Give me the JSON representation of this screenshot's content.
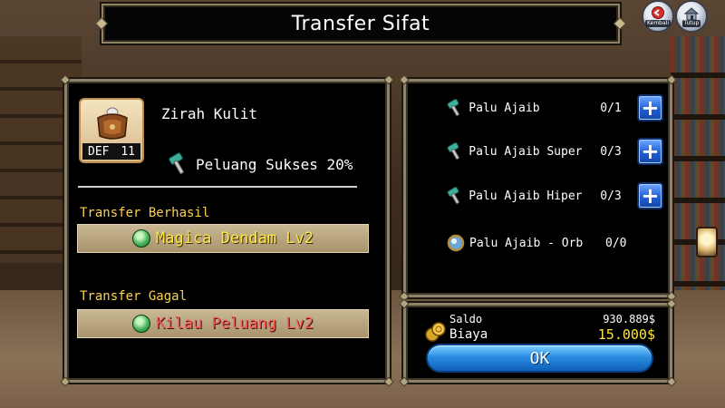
{
  "header": {
    "title": "Transfer Sifat",
    "back_label": "Kembali",
    "close_label": "Tutup"
  },
  "item": {
    "name": "Zirah Kulit",
    "stat_label": "DEF",
    "stat_value": "11",
    "success_chance_text": "Peluang Sukses 20%"
  },
  "transfer": {
    "success_label": "Transfer Berhasil",
    "success_result": "Magica Dendam Lv2",
    "fail_label": "Transfer Gagal",
    "fail_result": "Kilau Peluang Lv2"
  },
  "materials": [
    {
      "name": "Palu Ajaib",
      "count": "0/1",
      "icon": "hammer-icon",
      "has_add": true
    },
    {
      "name": "Palu Ajaib Super",
      "count": "0/3",
      "icon": "hammer-icon",
      "has_add": true
    },
    {
      "name": "Palu Ajaib Hiper",
      "count": "0/3",
      "icon": "hammer-icon",
      "has_add": true
    },
    {
      "name": "Palu Ajaib - Orb",
      "count": "0/0",
      "icon": "orb-icon",
      "has_add": false
    }
  ],
  "cost": {
    "saldo_label": "Saldo",
    "saldo_value": "930.889$",
    "biaya_label": "Biaya",
    "biaya_value": "15.000$",
    "ok_label": "OK"
  },
  "colors": {
    "section_label": "#ffd24a",
    "success_result": "#ffe640",
    "fail_result": "#ff5a5a",
    "panel_border": "#8d826a",
    "button_blue": "#2b8ce0"
  }
}
